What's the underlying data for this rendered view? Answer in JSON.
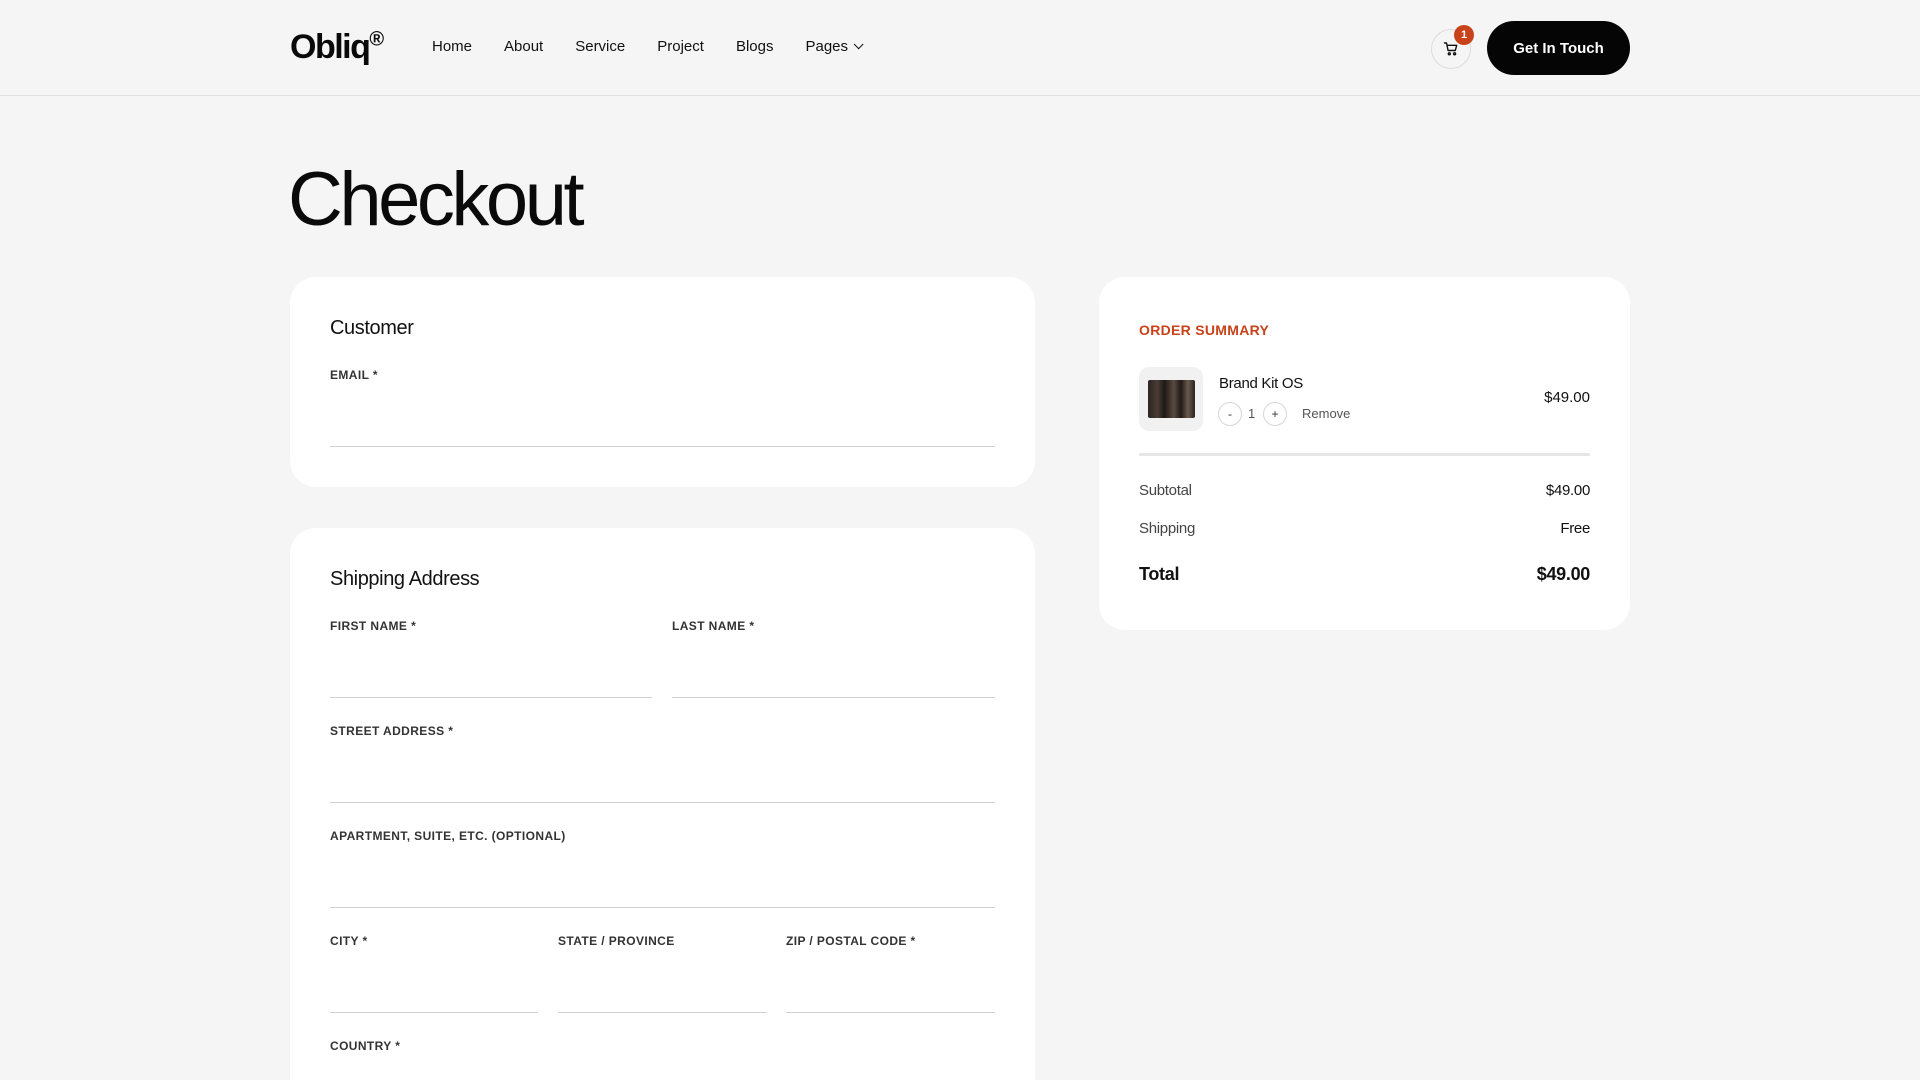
{
  "header": {
    "logo": "Obliq",
    "logo_mark": "®",
    "nav": [
      "Home",
      "About",
      "Service",
      "Project",
      "Blogs",
      "Pages"
    ],
    "cart_count": "1",
    "cta_label": "Get In Touch"
  },
  "page": {
    "title": "Checkout"
  },
  "customer": {
    "heading": "Customer",
    "email_label": "EMAIL *",
    "email_value": ""
  },
  "shipping": {
    "heading": "Shipping Address",
    "first_name_label": "FIRST NAME *",
    "last_name_label": "LAST NAME *",
    "street_label": "STREET ADDRESS *",
    "apartment_label": "APARTMENT, SUITE, ETC. (OPTIONAL)",
    "city_label": "CITY *",
    "state_label": "STATE / PROVINCE",
    "zip_label": "ZIP / POSTAL CODE *",
    "country_label": "COUNTRY *"
  },
  "summary": {
    "heading": "ORDER SUMMARY",
    "item": {
      "name": "Brand Kit OS",
      "qty": "1",
      "minus": "-",
      "plus": "+",
      "remove_label": "Remove",
      "price": "$49.00"
    },
    "subtotal_label": "Subtotal",
    "subtotal_value": "$49.00",
    "shipping_label": "Shipping",
    "shipping_value": "Free",
    "total_label": "Total",
    "total_value": "$49.00"
  },
  "colors": {
    "accent": "#c8421a",
    "button_bg": "#050505",
    "page_bg": "#f5f5f5"
  },
  "icons": {
    "cart": "cart-icon",
    "pages_dropdown": "chevron-down-icon"
  }
}
